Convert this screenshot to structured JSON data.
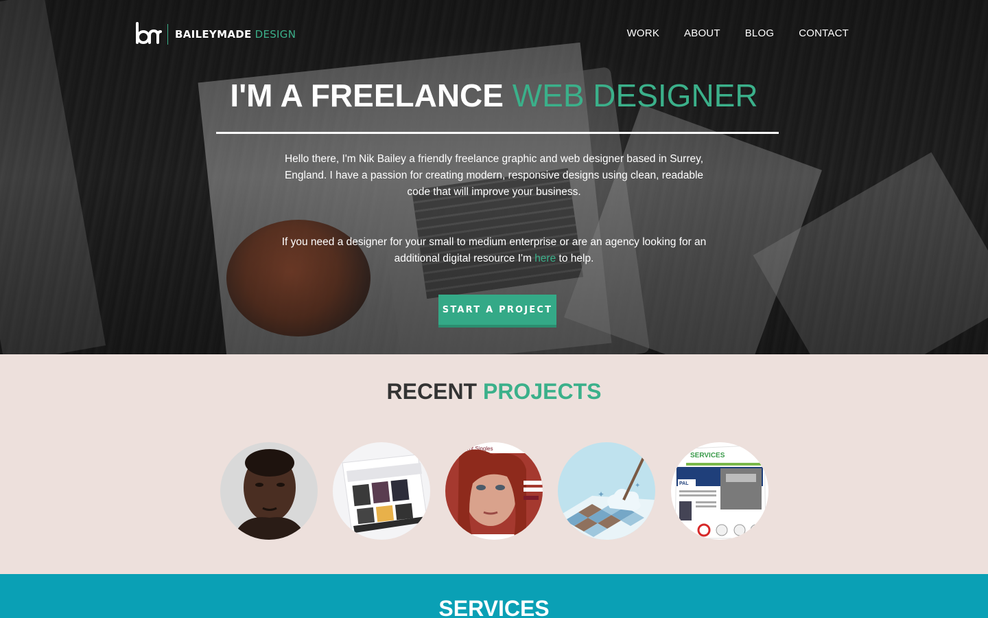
{
  "brand": {
    "name_bold": "BAILEYMADE",
    "name_light": " DESIGN",
    "logo_icon": "bm-monogram-icon",
    "accent": "#3bb08a"
  },
  "nav": {
    "items": [
      {
        "label": "WORK"
      },
      {
        "label": "ABOUT"
      },
      {
        "label": "BLOG"
      },
      {
        "label": "CONTACT"
      }
    ]
  },
  "hero": {
    "title_bold": "I'M A FREELANCE ",
    "title_accent": "WEB DESIGNER",
    "intro_lines": [
      "Hello there, I'm Nik Bailey a friendly freelance graphic and web designer based in Surrey,",
      "England. I have a passion for creating modern, responsive designs using clean, readable",
      "code that will improve your business."
    ],
    "pitch_line1": "If you need a designer for your small to medium enterprise or are an agency looking for an",
    "pitch_line2_before": "additional digital resource I'm ",
    "pitch_link": "here",
    "pitch_line2_after": " to help.",
    "cta_label": "START A PROJECT",
    "cta_color": "#34a987"
  },
  "projects": {
    "title_bold": "RECENT",
    "title_accent": " PROJECTS",
    "background": "#ede0dc",
    "thumb_signage": {
      "singles": "ent Singles",
      "services": "SERVICES",
      "pal": "PAL"
    },
    "items": [
      {
        "name": "portrait-project"
      },
      {
        "name": "agency-website-project"
      },
      {
        "name": "singles-dating-site-project"
      },
      {
        "name": "cleaning-brand-project"
      },
      {
        "name": "pal-services-project"
      }
    ]
  },
  "services": {
    "title": "SERVICES",
    "background": "#0aa0b5"
  }
}
